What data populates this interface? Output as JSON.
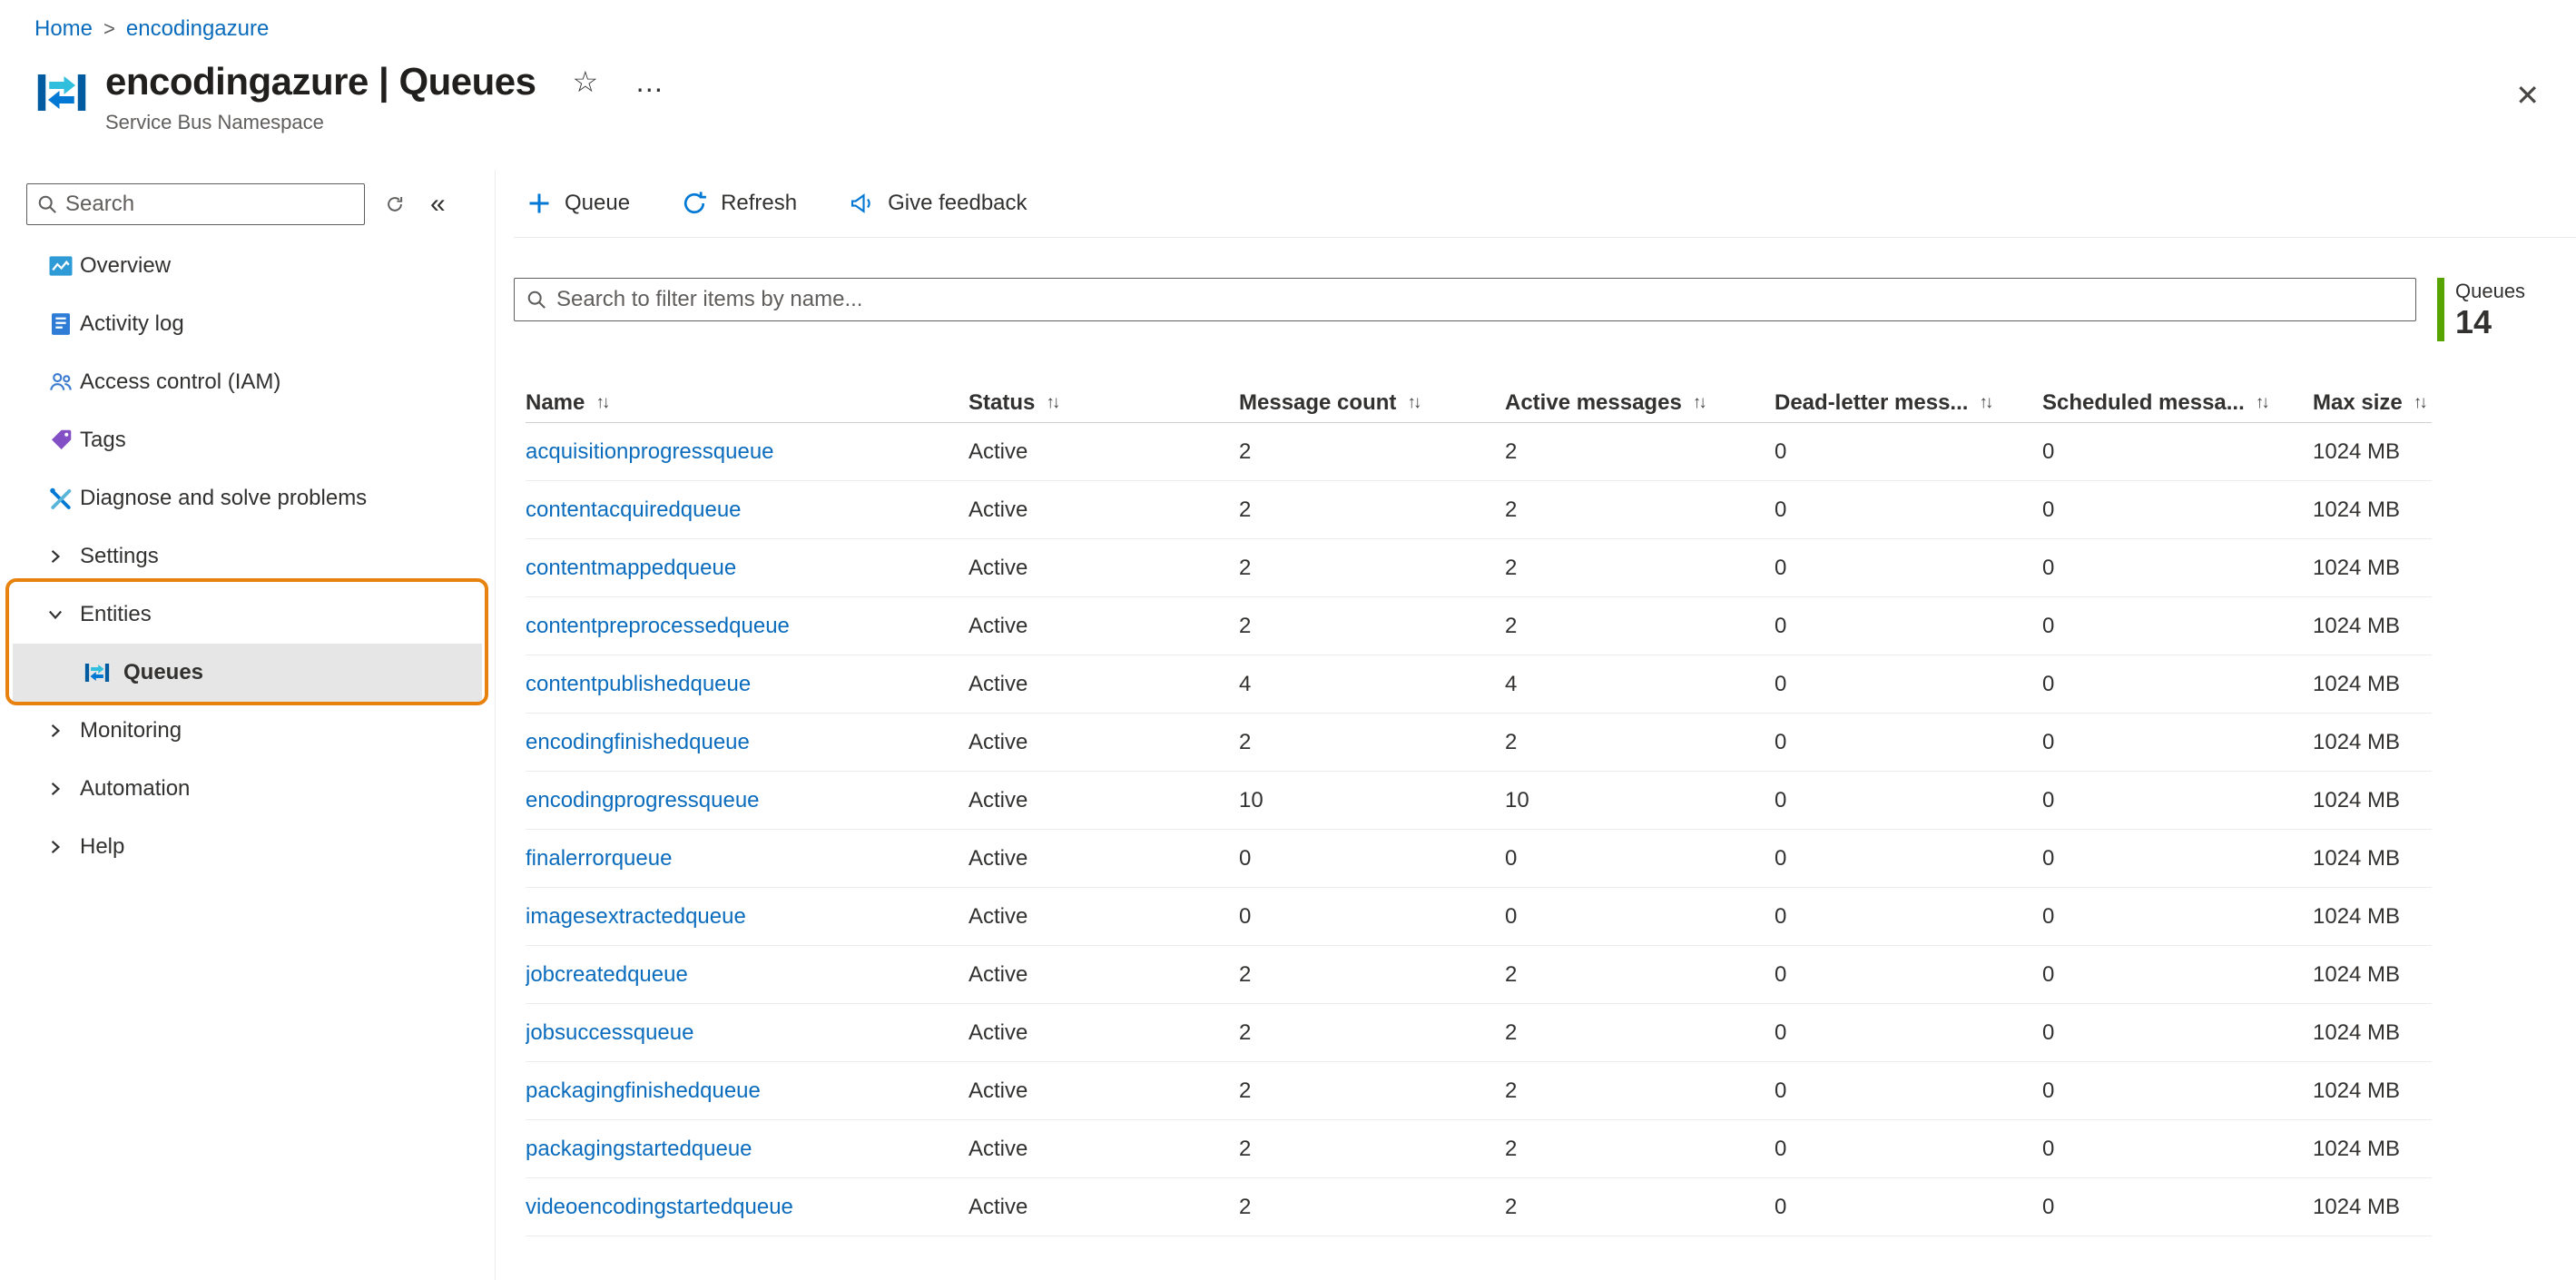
{
  "colors": {
    "link": "#0b6cbd",
    "accent": "#0078d4",
    "entities_highlight": "#e8820e",
    "count_bar": "#57a300"
  },
  "breadcrumb": {
    "items": [
      "Home",
      "encodingazure"
    ],
    "separator": ">"
  },
  "header": {
    "title": "encodingazure | Queues",
    "subtitle": "Service Bus Namespace"
  },
  "icons": {
    "star": "☆",
    "more": "…",
    "close": "✕",
    "collapse": "«",
    "sort": "↑↓"
  },
  "sidebar": {
    "search_placeholder": "Search",
    "items": [
      {
        "label": "Overview"
      },
      {
        "label": "Activity log"
      },
      {
        "label": "Access control (IAM)"
      },
      {
        "label": "Tags"
      },
      {
        "label": "Diagnose and solve problems"
      },
      {
        "label": "Settings"
      },
      {
        "label": "Entities"
      },
      {
        "label": "Queues"
      },
      {
        "label": "Monitoring"
      },
      {
        "label": "Automation"
      },
      {
        "label": "Help"
      }
    ]
  },
  "toolbar": {
    "queue": "Queue",
    "refresh": "Refresh",
    "feedback": "Give feedback"
  },
  "filter": {
    "placeholder": "Search to filter items by name..."
  },
  "summary": {
    "label": "Queues",
    "count": "14"
  },
  "table": {
    "columns": [
      {
        "label": "Name"
      },
      {
        "label": "Status"
      },
      {
        "label": "Message count"
      },
      {
        "label": "Active messages"
      },
      {
        "label": "Dead-letter mess..."
      },
      {
        "label": "Scheduled messa..."
      },
      {
        "label": "Max size"
      }
    ],
    "rows": [
      {
        "name": "acquisitionprogressqueue",
        "status": "Active",
        "message_count": "2",
        "active_messages": "2",
        "dead_letter": "0",
        "scheduled": "0",
        "max_size": "1024 MB"
      },
      {
        "name": "contentacquiredqueue",
        "status": "Active",
        "message_count": "2",
        "active_messages": "2",
        "dead_letter": "0",
        "scheduled": "0",
        "max_size": "1024 MB"
      },
      {
        "name": "contentmappedqueue",
        "status": "Active",
        "message_count": "2",
        "active_messages": "2",
        "dead_letter": "0",
        "scheduled": "0",
        "max_size": "1024 MB"
      },
      {
        "name": "contentpreprocessedqueue",
        "status": "Active",
        "message_count": "2",
        "active_messages": "2",
        "dead_letter": "0",
        "scheduled": "0",
        "max_size": "1024 MB"
      },
      {
        "name": "contentpublishedqueue",
        "status": "Active",
        "message_count": "4",
        "active_messages": "4",
        "dead_letter": "0",
        "scheduled": "0",
        "max_size": "1024 MB"
      },
      {
        "name": "encodingfinishedqueue",
        "status": "Active",
        "message_count": "2",
        "active_messages": "2",
        "dead_letter": "0",
        "scheduled": "0",
        "max_size": "1024 MB"
      },
      {
        "name": "encodingprogressqueue",
        "status": "Active",
        "message_count": "10",
        "active_messages": "10",
        "dead_letter": "0",
        "scheduled": "0",
        "max_size": "1024 MB"
      },
      {
        "name": "finalerrorqueue",
        "status": "Active",
        "message_count": "0",
        "active_messages": "0",
        "dead_letter": "0",
        "scheduled": "0",
        "max_size": "1024 MB"
      },
      {
        "name": "imagesextractedqueue",
        "status": "Active",
        "message_count": "0",
        "active_messages": "0",
        "dead_letter": "0",
        "scheduled": "0",
        "max_size": "1024 MB"
      },
      {
        "name": "jobcreatedqueue",
        "status": "Active",
        "message_count": "2",
        "active_messages": "2",
        "dead_letter": "0",
        "scheduled": "0",
        "max_size": "1024 MB"
      },
      {
        "name": "jobsuccessqueue",
        "status": "Active",
        "message_count": "2",
        "active_messages": "2",
        "dead_letter": "0",
        "scheduled": "0",
        "max_size": "1024 MB"
      },
      {
        "name": "packagingfinishedqueue",
        "status": "Active",
        "message_count": "2",
        "active_messages": "2",
        "dead_letter": "0",
        "scheduled": "0",
        "max_size": "1024 MB"
      },
      {
        "name": "packagingstartedqueue",
        "status": "Active",
        "message_count": "2",
        "active_messages": "2",
        "dead_letter": "0",
        "scheduled": "0",
        "max_size": "1024 MB"
      },
      {
        "name": "videoencodingstartedqueue",
        "status": "Active",
        "message_count": "2",
        "active_messages": "2",
        "dead_letter": "0",
        "scheduled": "0",
        "max_size": "1024 MB"
      }
    ]
  }
}
